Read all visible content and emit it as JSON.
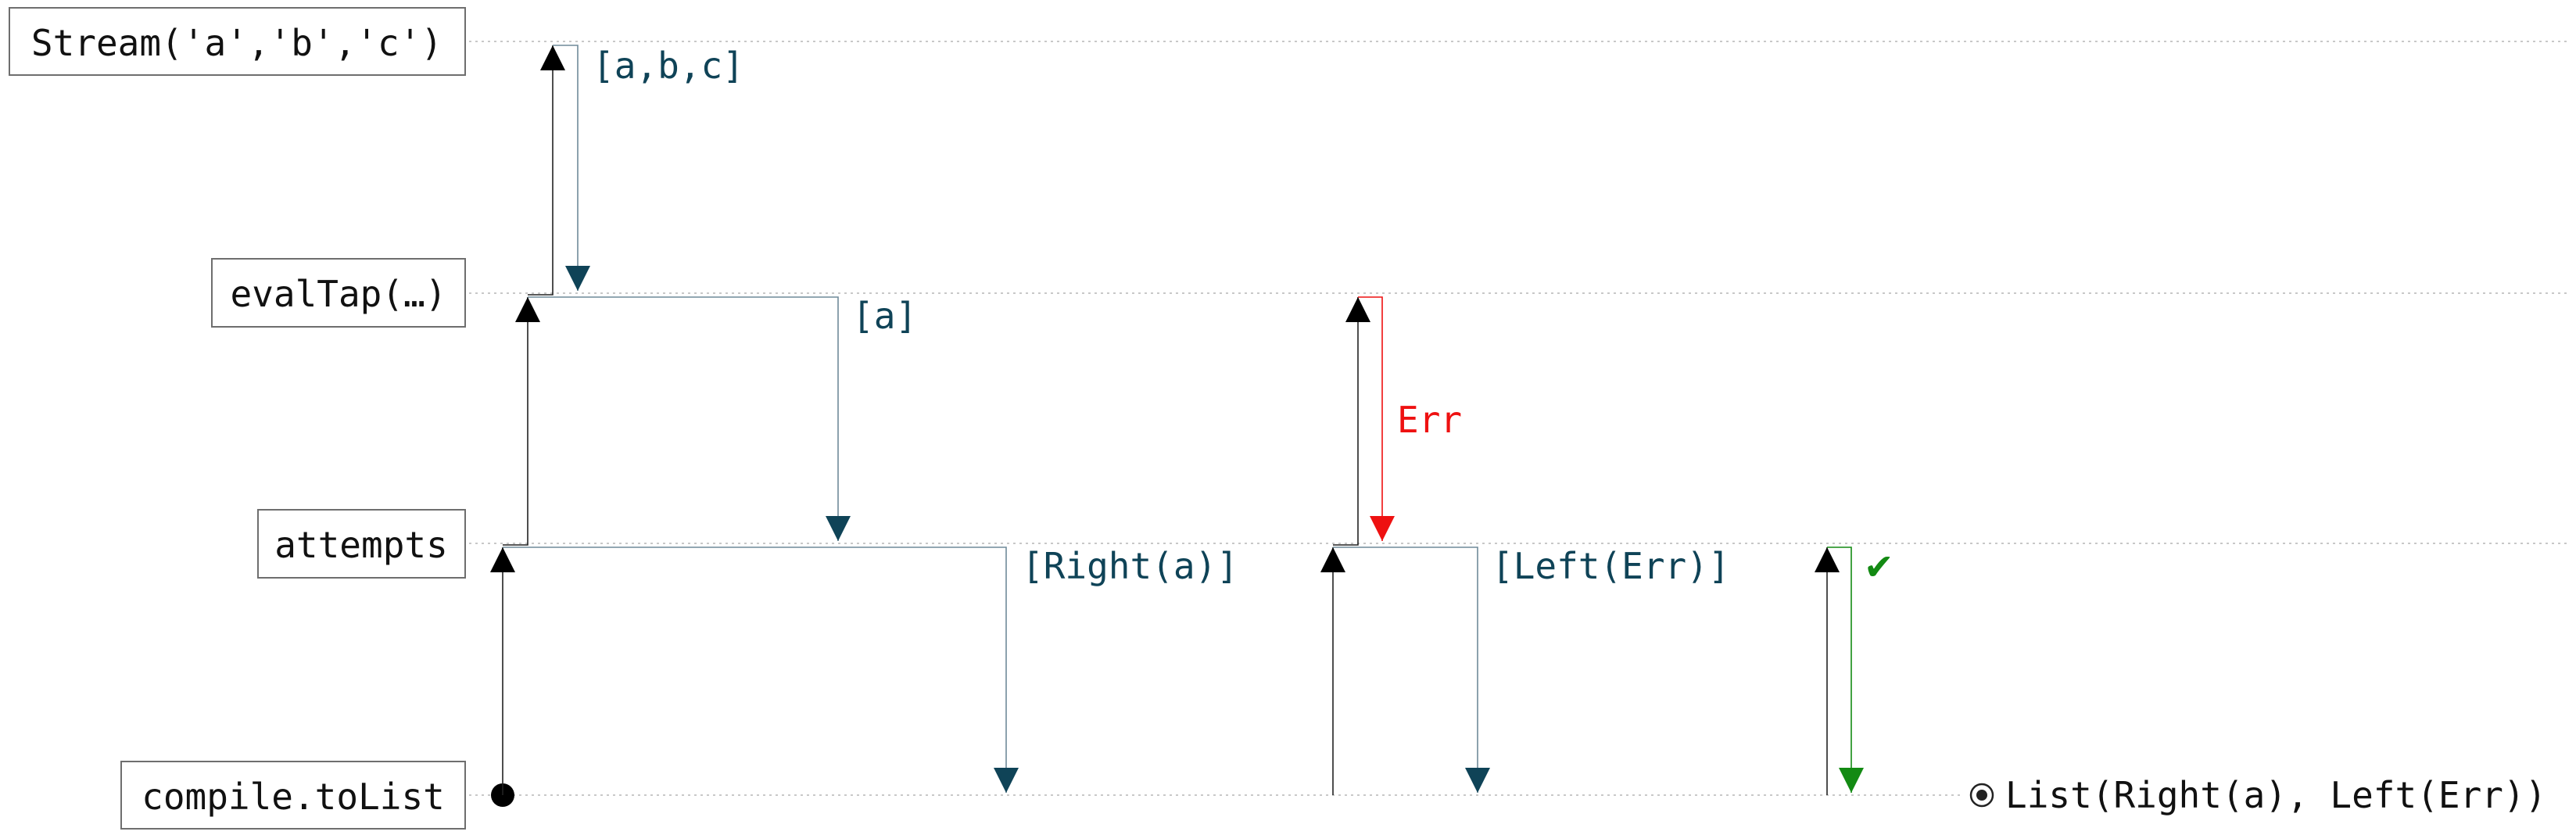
{
  "lanes": [
    {
      "id": "stream",
      "label": "Stream('a','b','c')"
    },
    {
      "id": "evaltap",
      "label": "evalTap(…)"
    },
    {
      "id": "attempts",
      "label": "attempts"
    },
    {
      "id": "tolist",
      "label": "compile.toList"
    }
  ],
  "messages": {
    "stream_to_evaltap": "[a,b,c]",
    "evaltap_to_attempts_a": "[a]",
    "evaltap_err": "Err",
    "attempts_right": "[Right(a)]",
    "attempts_left": "[Left(Err)]",
    "attempts_done": "✔"
  },
  "result": "List(Right(a), Left(Err))",
  "colors": {
    "data_arrow": "#0f4357",
    "data_line": "#6f8a99",
    "error": "#ee1111",
    "done": "#138a13",
    "request": "#000000"
  }
}
